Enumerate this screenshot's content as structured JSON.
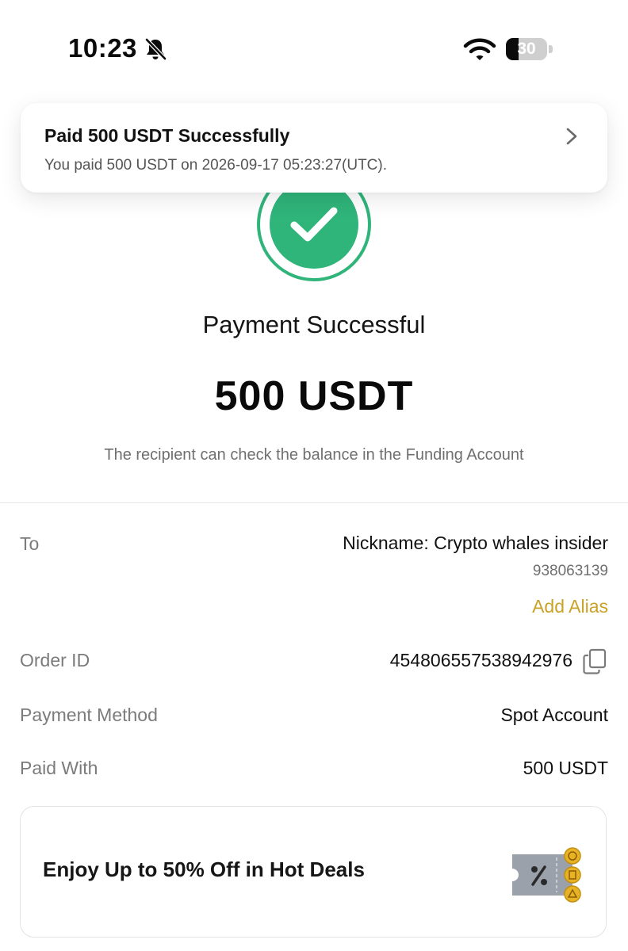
{
  "status_bar": {
    "time": "10:23",
    "battery_level": "30",
    "battery_fraction": 0.3,
    "icons": [
      "bell-off-icon",
      "wifi-icon",
      "battery-icon"
    ]
  },
  "notification": {
    "title": "Paid 500 USDT Successfully",
    "message": "You paid 500 USDT on 2026-09-17 05:23:27(UTC).",
    "icon": "chevron-right-icon"
  },
  "result": {
    "icon": "success-check-icon",
    "title": "Payment Successful",
    "amount": "500 USDT",
    "note": "The recipient can check the balance in the Funding Account"
  },
  "details": {
    "to_label": "To",
    "to_value": "Nickname: Crypto whales insider",
    "to_id": "938063139",
    "add_alias": "Add Alias",
    "order_id_label": "Order ID",
    "order_id_value": "454806557538942976",
    "payment_method_label": "Payment Method",
    "payment_method_value": "Spot Account",
    "paid_with_label": "Paid With",
    "paid_with_value": "500 USDT"
  },
  "promo": {
    "title": "Enjoy Up to 50% Off in Hot Deals",
    "icon": "discount-coupon-icon"
  },
  "colors": {
    "success_green": "#2fb47a",
    "accent_gold": "#c9a227",
    "coin_gold": "#e7b325",
    "coupon_gray": "#9aa1ab"
  }
}
